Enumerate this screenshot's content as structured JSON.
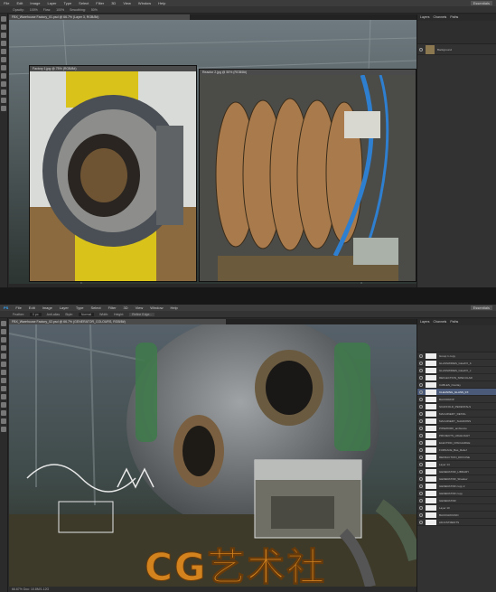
{
  "top": {
    "menu": [
      "File",
      "Edit",
      "Image",
      "Layer",
      "Type",
      "Select",
      "Filter",
      "3D",
      "View",
      "Window",
      "Help"
    ],
    "options": [
      "Opacity:",
      "100%",
      "Flow:",
      "100%",
      "Smoothing:",
      "50%"
    ],
    "main_tab": "FBX_Warehouse Factory_01.psd @ 66.7% (Layer 3, RGB/8#)",
    "doc_tab_1": "Factory 1.jpg @ 75% (RGB/8#)",
    "doc_tab_2": "Reactor 2.jpg @ 50% (RGB/8#)",
    "right_label": "Essentials",
    "panel_tabs": [
      "Layers",
      "Channels",
      "Paths"
    ],
    "panel_layer": "Background"
  },
  "bottom": {
    "menu": [
      "PS",
      "File",
      "Edit",
      "Image",
      "Layer",
      "Type",
      "Select",
      "Filter",
      "3D",
      "View",
      "Window",
      "Help"
    ],
    "options": [
      "Feather:",
      "0 px",
      "Anti-alias",
      "Style:",
      "Normal",
      "Width:",
      "Height:",
      "Refine Edge..."
    ],
    "main_tab": "FBX_Warehouse Factory_02.psd @ 66.7% (GENERATOR_COLOURS, RGB/8#)",
    "status": "66.67%    Doc: 10.8M/1.12G",
    "right_label": "Essentials",
    "panel_tabs": [
      "Layers",
      "Channels",
      "Paths"
    ],
    "layers": [
      "Group 1 copy",
      "GLASSWIRES_GlowFX_b",
      "GLASSWIRES_GlowFX_c",
      "REFLECTION_SPECULAR",
      "CABLES_Overlay",
      "CLEANING_GLASS_FX",
      "BACKDROP",
      "SCAFFOLD_PEDESTALS",
      "MACHINERY_DETAIL",
      "MACHINERY_SHADOWS",
      "PIPEWORK_ambience",
      "PROJECTS_HIGHLIGHT",
      "ELECTRIC_DISCHARGE",
      "FURNACE_Bas_Relief",
      "REFRACTION_DIFFUSE",
      "Layer 14",
      "GENERATOR_LIBRARY",
      "GENERATOR_Shadow",
      "GENERATOR copy 2",
      "GENERATOR copy",
      "GENERATOR",
      "Layer 10",
      "BACKGROUND",
      "ADJUSTMENTS"
    ],
    "selected_layer_index": 5
  },
  "watermark": "CG艺术社",
  "colors": {
    "accent": "#4a5a78",
    "watermark": "#e08a1e",
    "ui_bg": "#282828"
  }
}
